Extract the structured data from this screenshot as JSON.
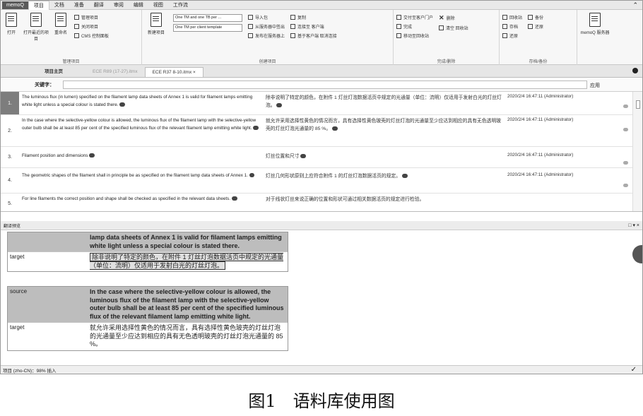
{
  "app": {
    "logo": "memoQ"
  },
  "ribbon_tabs": [
    "项目",
    "文档",
    "准备",
    "翻译",
    "审阅",
    "编辑",
    "视图",
    "工作流"
  ],
  "ribbon": {
    "group_manage": {
      "label": "管理项目",
      "open": "打开",
      "open_recent": "打开最近的项目",
      "recycle": "重命名",
      "items": [
        "管理项目",
        "关闭项目",
        "CMS 控制面板"
      ]
    },
    "group_create": {
      "label": "创建项目",
      "new_project": "新建项目",
      "template_boxes": [
        "One TM and one TB per ...",
        "One TM per client template"
      ],
      "items_a": [
        "导入包",
        "从服务器中签出",
        "发布在服务器上"
      ],
      "items_b": [
        "复制",
        "连接至 客户端",
        "基于客户端 取消连接"
      ]
    },
    "group_complete": {
      "label": "完成/删除",
      "items_a": [
        "交付至客户门户",
        "完成",
        "移动至回收站"
      ],
      "items_b": [
        "删除",
        "清空 回收站"
      ]
    },
    "group_archive": {
      "label": "存档/备份",
      "items_a": [
        "回收站",
        "存档",
        "还原"
      ],
      "items_b": [
        "备份",
        "还原"
      ],
      "server": "memoQ 服务器"
    }
  },
  "doc_tabs": [
    {
      "label": "项目主页"
    },
    {
      "label": "ECE R89 (17-27).itmx"
    },
    {
      "label": "ECE R37 8-10.itmx ×"
    }
  ],
  "filter": {
    "keyword_label": "关键字：",
    "apply": "应用"
  },
  "grid_rows": [
    {
      "num": "1.",
      "source": "The luminous flux (in lumen) specified on the filament lamp data sheets of Annex 1 is valid for filament lamps emitting white light unless a special colour is stated there.",
      "target": "除非说明了特定的颜色，在附件 1 灯丝灯泡数据活页中规定的光通量（单位：流明）仅适用于发射白光的灯丝灯泡。",
      "meta": "2020/2/4 16:47:11 (Administrator)"
    },
    {
      "num": "2.",
      "source": "In the case where the selective-yellow colour is allowed, the luminous flux of the filament lamp with the selective-yellow outer bulb shall be at least 85 per cent of the specified luminous flux of the relevant filament lamp emitting white light.",
      "target": "就允许采用选择性黄色的情况而言，具有选择性黄色玻壳的灯丝灯泡的光通量至少应达到相应的具有无色透明玻壳的灯丝灯泡光通量的 85 %。",
      "meta": "2020/2/4 16:47:11 (Administrator)"
    },
    {
      "num": "3.",
      "source": "Filament position and dimensions",
      "target": "灯丝位置和尺寸",
      "meta": "2020/2/4 16:47:11 (Administrator)"
    },
    {
      "num": "4.",
      "source": "The geometric shapes of the filament shall in principle be as specified on the filament lamp data sheets of Annex 1.",
      "target": "灯丝几何形状原则上应符合附件 1 的灯丝灯泡数据活页的规定。",
      "meta": "2020/2/4 16:47:11 (Administrator)"
    },
    {
      "num": "5.",
      "source": "For line filaments the correct position and shape shall be checked as specified in the relevant data sheets.",
      "target": "对于线状灯丝来说正确的位置和形状可通过相关数据活页的规定进行检验。",
      "meta": ""
    }
  ],
  "panel": {
    "title": "翻译预览",
    "controls": "□ ▾ ×",
    "blocks": [
      {
        "source_label": "",
        "source": "lamp data sheets of Annex 1 is valid for filament lamps emitting white light unless a special colour is stated there.",
        "target_label": "target",
        "target": "除非说明了特定的颜色，在附件 1 灯丝灯泡数据活页中规定的光通量（单位：流明）仅适用于发射白光的灯丝灯泡。"
      },
      {
        "source_label": "source",
        "source": "In the case where the selective-yellow colour is allowed, the luminous flux of the filament lamp with the selective-yellow outer bulb shall be at least 85 per cent of the specified luminous flux of the relevant filament lamp emitting white light.",
        "target_label": "target",
        "target": "就允许采用选择性黄色的情况而言，具有选择性黄色玻壳的灯丝灯泡的光通量至少应达到相应的具有无色透明玻壳的灯丝灯泡光通量的 85 %。"
      }
    ]
  },
  "status": {
    "text": "项目 (zho-CN)：98% 插入",
    "check": "✓"
  },
  "caption": "图1　语料库使用图"
}
